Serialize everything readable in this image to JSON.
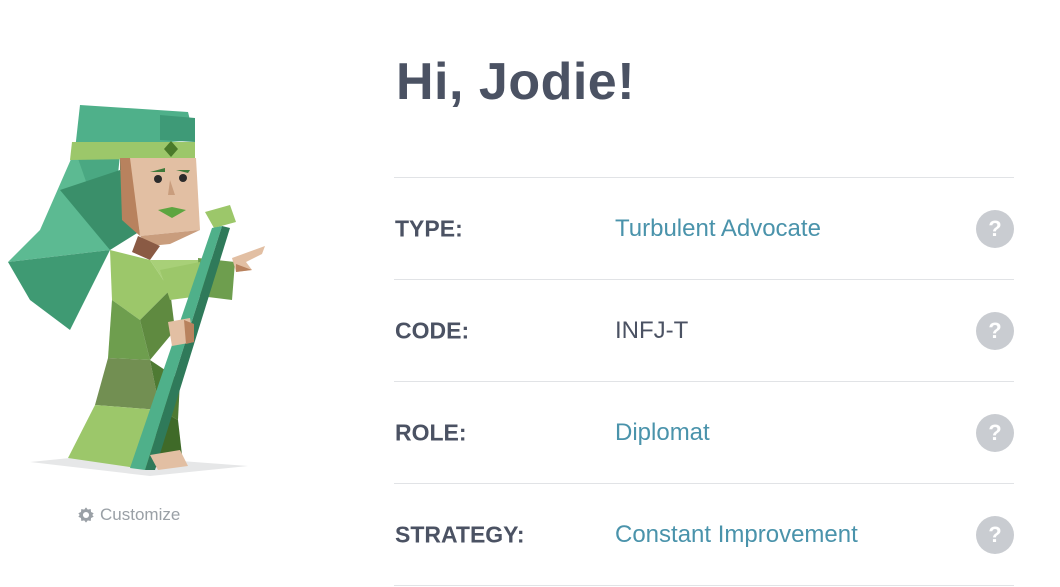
{
  "profile": {
    "greeting": "Hi, Jodie!",
    "customize_label": "Customize",
    "help_glyph": "?",
    "rows": [
      {
        "label": "TYPE:",
        "value": "Turbulent Advocate",
        "value_style": "link"
      },
      {
        "label": "CODE:",
        "value": "INFJ-T",
        "value_style": "plain"
      },
      {
        "label": "ROLE:",
        "value": "Diplomat",
        "value_style": "link"
      },
      {
        "label": "STRATEGY:",
        "value": "Constant Improvement",
        "value_style": "link"
      }
    ]
  },
  "colors": {
    "heading": "#4b5263",
    "link": "#4a93ab",
    "divider": "#e1e3e6",
    "help_badge": "#c9ccd1",
    "muted": "#9aa0a6"
  },
  "icons": {
    "customize": "gear-icon",
    "help": "question-mark-icon"
  }
}
